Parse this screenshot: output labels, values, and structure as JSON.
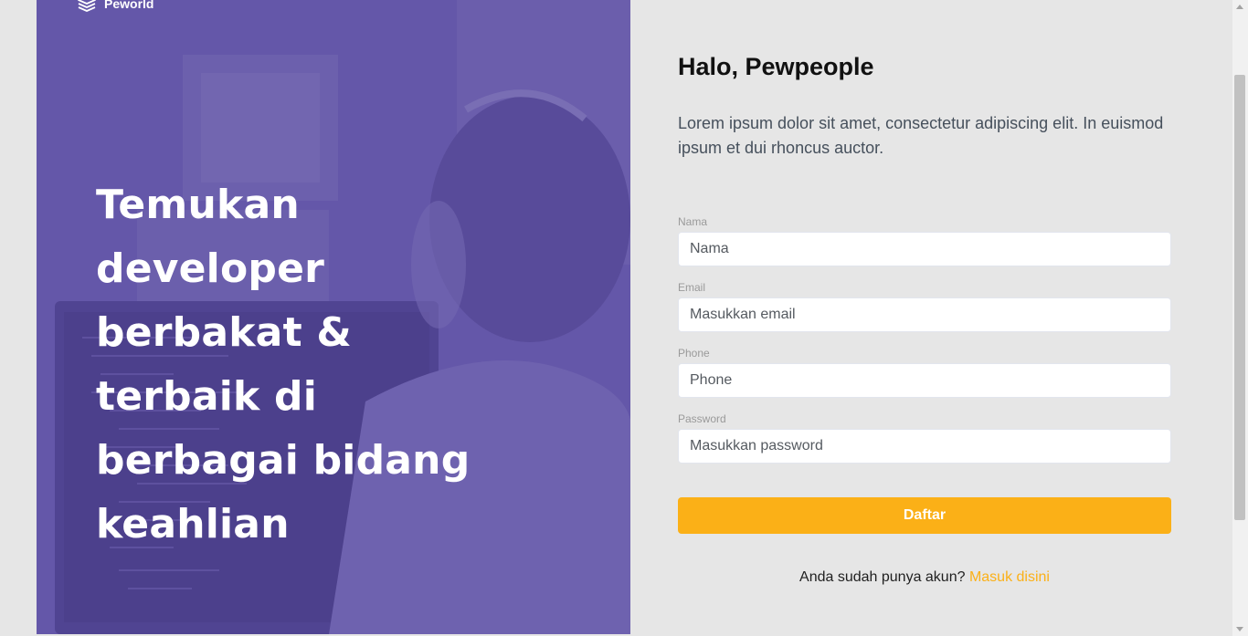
{
  "brand": {
    "name": "Peworld"
  },
  "hero": {
    "headline": "Temukan developer berbakat & terbaik di berbagai bidang keahlian"
  },
  "form": {
    "title": "Halo, Pewpeople",
    "description": "Lorem ipsum dolor sit amet, consectetur adipiscing elit. In euismod ipsum et dui rhoncus auctor.",
    "fields": [
      {
        "label": "Nama",
        "placeholder": "Nama",
        "type": "text"
      },
      {
        "label": "Email",
        "placeholder": "Masukkan email",
        "type": "email"
      },
      {
        "label": "Phone",
        "placeholder": "Phone",
        "type": "tel"
      },
      {
        "label": "Password",
        "placeholder": "Masukkan password",
        "type": "password"
      }
    ],
    "submit_label": "Daftar",
    "login_prompt": "Anda sudah punya akun?",
    "login_link": "Masuk disini"
  },
  "colors": {
    "accent": "#fbb017",
    "hero_purple": "#5e50a1",
    "background": "#e6e6e6"
  }
}
